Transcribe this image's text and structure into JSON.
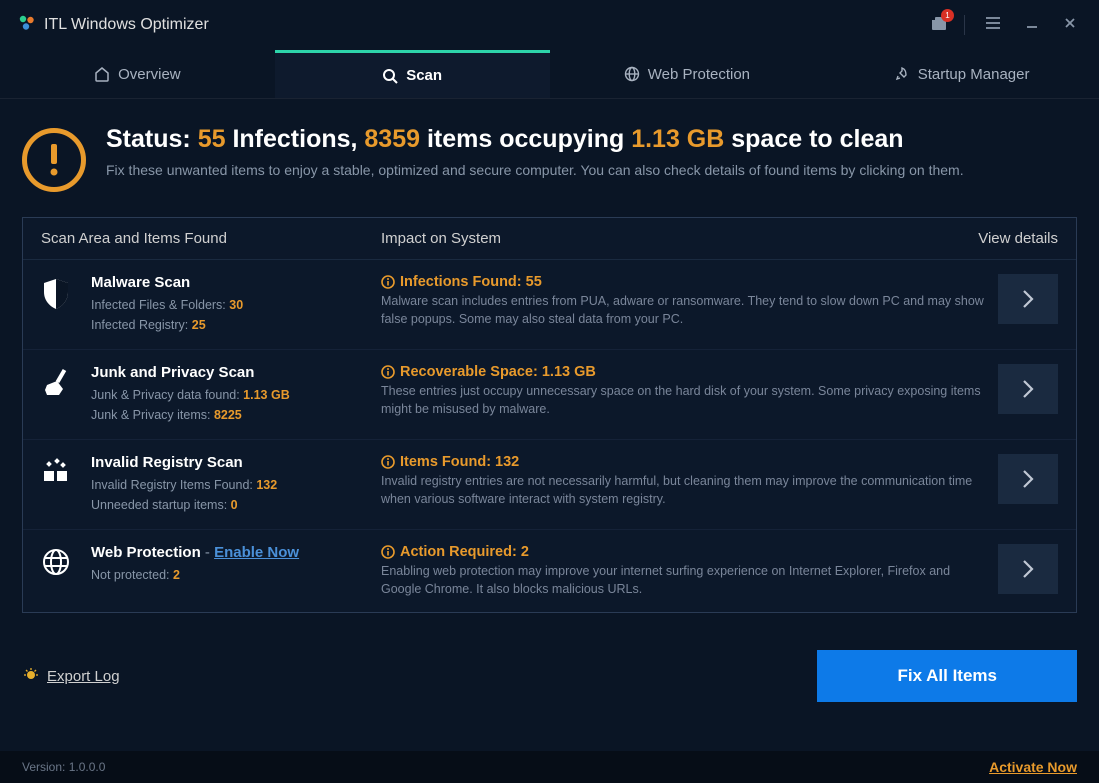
{
  "app": {
    "title": "ITL Windows Optimizer",
    "notifCount": "1"
  },
  "tabs": {
    "overview": "Overview",
    "scan": "Scan",
    "web": "Web Protection",
    "startup": "Startup Manager"
  },
  "status": {
    "prefix": "Status: ",
    "infectionsCount": "55",
    "infectionsWord": " Infections, ",
    "itemsCount": "8359",
    "itemsWord": " items occupying ",
    "size": "1.13 GB",
    "suffix": " space to clean",
    "desc": "Fix these unwanted items to enjoy a stable, optimized and secure computer. You can also check details of found items by clicking on them."
  },
  "columns": {
    "left": "Scan Area and Items Found",
    "mid": "Impact on System",
    "right": "View details"
  },
  "rows": {
    "malware": {
      "title": "Malware Scan",
      "sub1_label": "Infected Files & Folders: ",
      "sub1_val": "30",
      "sub2_label": "Infected Registry: ",
      "sub2_val": "25",
      "impact_title": "Infections Found: 55",
      "impact_desc": "Malware scan includes entries from PUA, adware or ransomware. They tend to slow down PC and may show false popups. Some may also steal data from your PC."
    },
    "junk": {
      "title": "Junk and Privacy Scan",
      "sub1_label": "Junk & Privacy data found: ",
      "sub1_val": "1.13 GB",
      "sub2_label": "Junk & Privacy items: ",
      "sub2_val": "8225",
      "impact_title": "Recoverable Space: 1.13 GB",
      "impact_desc": "These entries just occupy unnecessary space on the hard disk of your system. Some privacy exposing items might be misused by malware."
    },
    "registry": {
      "title": "Invalid Registry Scan",
      "sub1_label": "Invalid Registry Items Found: ",
      "sub1_val": "132",
      "sub2_label": "Unneeded startup items: ",
      "sub2_val": "0",
      "impact_title": "Items Found: 132",
      "impact_desc": "Invalid registry entries are not necessarily harmful, but cleaning them may improve the communication time when various software interact with system registry."
    },
    "web": {
      "title": "Web Protection",
      "separator": "  -  ",
      "link": "Enable Now",
      "sub1_label": "Not protected: ",
      "sub1_val": "2",
      "impact_title": "Action Required: 2",
      "impact_desc": "Enabling web protection may improve your internet surfing experience on Internet Explorer, Firefox and Google Chrome. It also blocks malicious URLs."
    }
  },
  "actions": {
    "exportLog": "Export Log",
    "fixAll": "Fix All Items"
  },
  "bottom": {
    "version": "Version: 1.0.0.0",
    "activate": "Activate Now"
  }
}
